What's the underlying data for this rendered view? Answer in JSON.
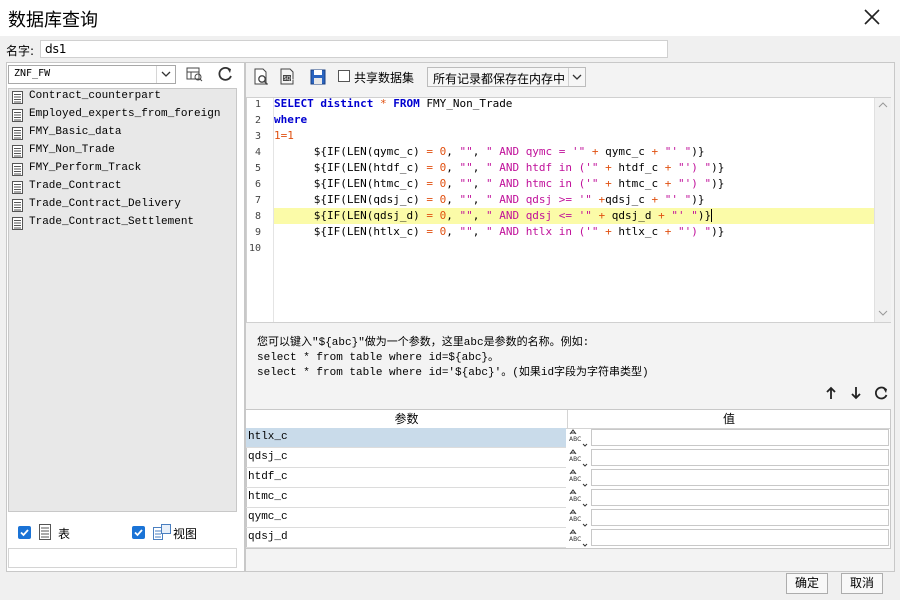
{
  "window": {
    "title": "数据库查询"
  },
  "name_field": {
    "label": "名字:",
    "value": "ds1"
  },
  "left": {
    "db_select": "ZNF_FW",
    "tables": [
      "Contract_counterpart",
      "Employed_experts_from_foreign",
      "FMY_Basic_data",
      "FMY_Non_Trade",
      "FMY_Perform_Track",
      "Trade_Contract",
      "Trade_Contract_Delivery",
      "Trade_Contract_Settlement"
    ],
    "filter_table_label": "表",
    "filter_view_label": "视图"
  },
  "toolbar": {
    "share_label": "共享数据集",
    "memory_option": "所有记录都保存在内存中"
  },
  "editor": {
    "line_numbers": [
      "1",
      "2",
      "3",
      "4",
      "5",
      "6",
      "7",
      "8",
      "9",
      "10"
    ],
    "highlighted_line": 8
  },
  "hint": {
    "line1": "您可以键入\"${abc}\"做为一个参数，这里abc是参数的名称。例如:",
    "line2": "select * from table where id=${abc}。",
    "line3": "select * from table where id='${abc}'。(如果id字段为字符串类型)"
  },
  "params": {
    "col_name": "参数",
    "col_value": "值",
    "type_badge": "ABC",
    "rows": [
      {
        "name": "htlx_c",
        "value": ""
      },
      {
        "name": "qdsj_c",
        "value": ""
      },
      {
        "name": "htdf_c",
        "value": ""
      },
      {
        "name": "htmc_c",
        "value": ""
      },
      {
        "name": "qymc_c",
        "value": ""
      },
      {
        "name": "qdsj_d",
        "value": ""
      }
    ]
  },
  "footer": {
    "ok": "确定",
    "cancel": "取消"
  },
  "colors": {
    "keyword": "#0000d0",
    "string": "#c0109a",
    "number": "#e05010",
    "highlight": "#fbfba8",
    "selected_row": "#c9dbea"
  }
}
